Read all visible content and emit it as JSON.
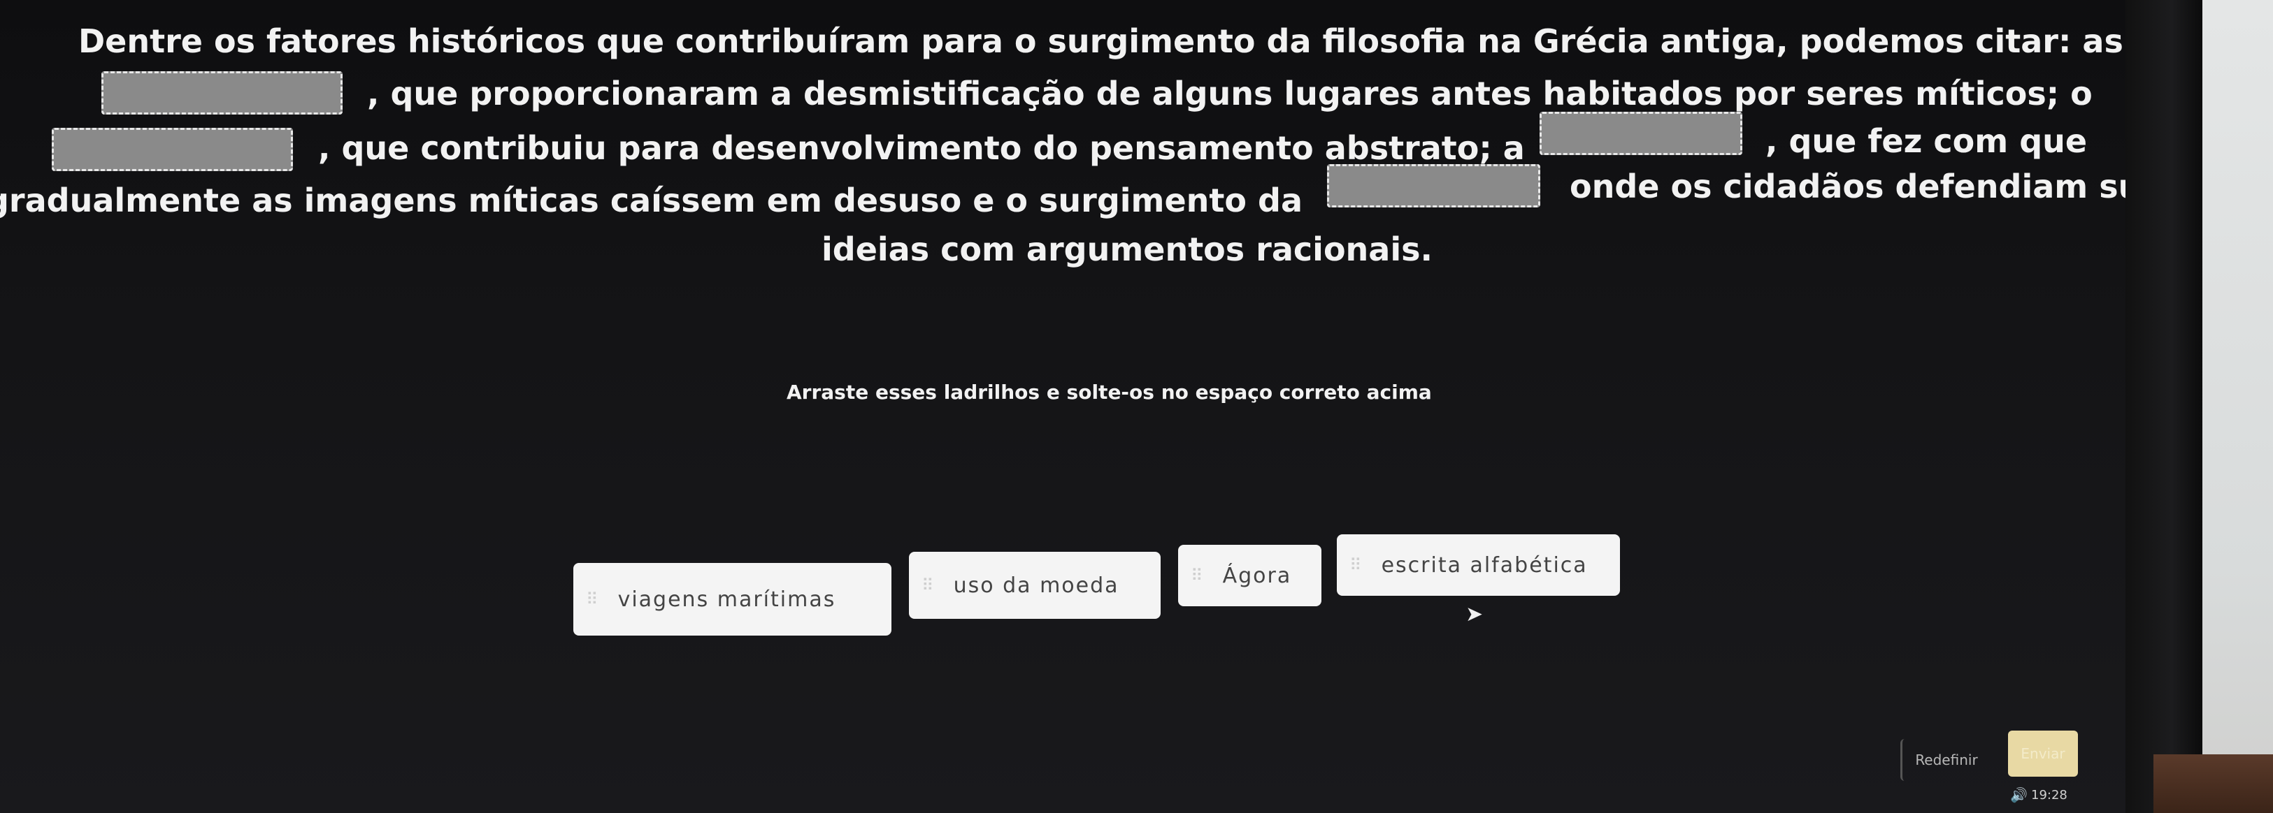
{
  "question": {
    "line1": "Dentre os fatores históricos que contribuíram para o surgimento da filosofia na Grécia antiga, podemos citar: as",
    "line2": ", que proporcionaram a desmistificação de alguns lugares antes habitados por seres míticos; o",
    "line3a": ", que contribuiu para desenvolvimento do pensamento abstrato;  a",
    "line3b": ", que fez com que",
    "line4a": "gradualmente as imagens míticas caíssem em desuso e o surgimento da",
    "line4b": "onde os cidadãos defendiam suas",
    "line5": "ideias com argumentos racionais."
  },
  "instruction": "Arraste esses ladrilhos e solte-os no espaço correto acima",
  "tiles": [
    {
      "label": "viagens marítimas"
    },
    {
      "label": "uso da moeda"
    },
    {
      "label": "Ágora"
    },
    {
      "label": "escrita alfabética"
    }
  ],
  "buttons": {
    "reset": "Redefinir",
    "send": "Enviar"
  },
  "taskbar": {
    "time": "19:28",
    "grip": "⠿",
    "speaker": "🔊"
  },
  "colors": {
    "tile_bg": "#f4f4f4",
    "blank_bg": "#8a8a8a",
    "send_bg": "#e8d9a4"
  }
}
